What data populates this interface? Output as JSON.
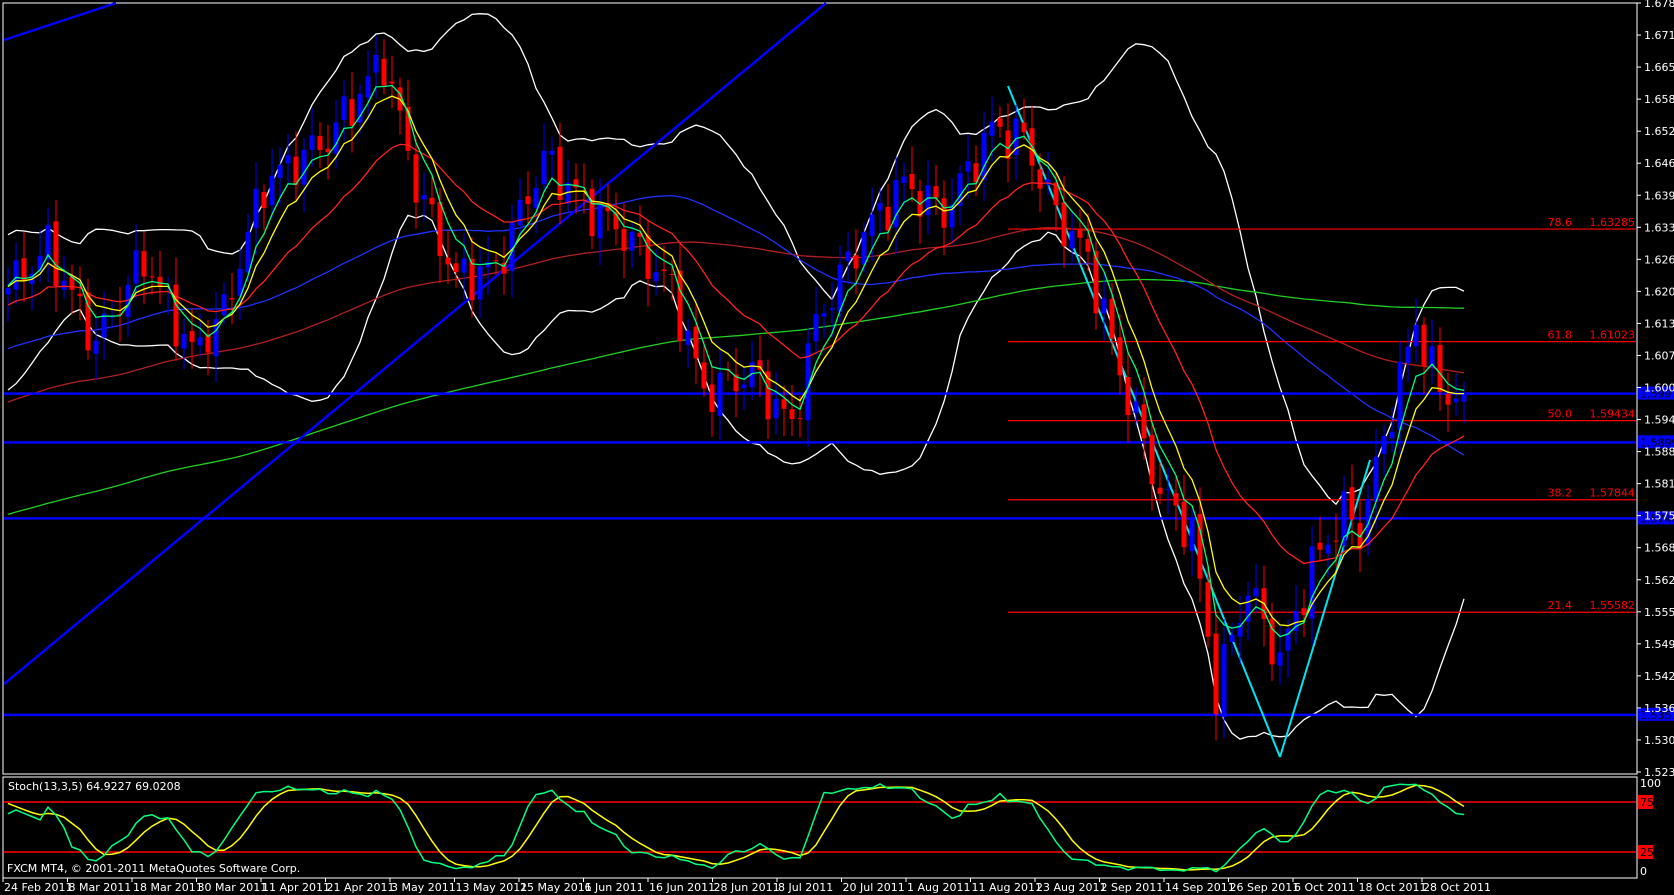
{
  "chart_data": {
    "type": "candlestick",
    "symbol_info": "FXCM MT4, © 2001-2011 MetaQuotes Software Corp.",
    "indicator_label": "Stoch(13,3,5) 64.9227 69.0208",
    "price_ticks": [
      "1.67830",
      "1.67190",
      "1.66550",
      "1.65890",
      "1.65250",
      "1.64610",
      "1.63970",
      "1.63310",
      "1.62670",
      "1.62030",
      "1.61390",
      "1.60730",
      "1.60090",
      "1.59450",
      "1.58810",
      "1.58170",
      "1.57530",
      "1.56870",
      "1.56230",
      "1.55590",
      "1.54930",
      "1.54290",
      "1.53650",
      "1.53010",
      "1.52370"
    ],
    "ylim": [
      1.5237,
      1.6783
    ],
    "stoch_ticks": [
      "100",
      "75",
      "25",
      "0"
    ],
    "stoch_levels": [
      75,
      25
    ],
    "date_labels": [
      "24 Feb 2011",
      "8 Mar 2011",
      "18 Mar 2011",
      "30 Mar 2011",
      "11 Apr 2011",
      "21 Apr 2011",
      "3 May 2011",
      "13 May 2011",
      "25 May 2011",
      "6 Jun 2011",
      "16 Jun 2011",
      "28 Jun 2011",
      "8 Jul 2011",
      "20 Jul 2011",
      "1 Aug 2011",
      "11 Aug 2011",
      "23 Aug 2011",
      "2 Sep 2011",
      "14 Sep 2011",
      "26 Sep 2011",
      "6 Oct 2011",
      "18 Oct 2011",
      "28 Oct 2011"
    ],
    "close_anchors": [
      [
        0,
        1.621
      ],
      [
        5,
        1.629
      ],
      [
        11,
        1.61
      ],
      [
        17,
        1.627
      ],
      [
        23,
        1.608
      ],
      [
        27,
        1.616
      ],
      [
        32,
        1.642
      ],
      [
        40,
        1.651
      ],
      [
        47,
        1.667
      ],
      [
        51,
        1.642
      ],
      [
        56,
        1.623
      ],
      [
        61,
        1.625
      ],
      [
        67,
        1.647
      ],
      [
        72,
        1.638
      ],
      [
        77,
        1.632
      ],
      [
        83,
        1.621
      ],
      [
        87,
        1.6
      ],
      [
        93,
        1.604
      ],
      [
        98,
        1.593
      ],
      [
        101,
        1.614
      ],
      [
        107,
        1.632
      ],
      [
        112,
        1.642
      ],
      [
        117,
        1.636
      ],
      [
        123,
        1.653
      ],
      [
        127,
        1.651
      ],
      [
        131,
        1.636
      ],
      [
        135,
        1.627
      ],
      [
        139,
        1.604
      ],
      [
        144,
        1.58
      ],
      [
        148,
        1.572
      ],
      [
        151,
        1.54
      ],
      [
        155,
        1.561
      ],
      [
        159,
        1.546
      ],
      [
        163,
        1.565
      ],
      [
        167,
        1.576
      ],
      [
        169,
        1.572
      ],
      [
        173,
        1.597
      ],
      [
        176,
        1.614
      ],
      [
        179,
        1.6
      ],
      [
        182,
        1.5998
      ]
    ],
    "horizontal_lines": [
      {
        "price": 1.59978,
        "label": "1.59978"
      },
      {
        "price": 1.58998,
        "label": "1.58998"
      },
      {
        "price": 1.57469,
        "label": "1.57469"
      },
      {
        "price": 1.53519,
        "label": "1.53519"
      }
    ],
    "fibonacci": [
      {
        "level": "78.6",
        "price": 1.63285,
        "label": "1.63285"
      },
      {
        "level": "61.8",
        "price": 1.61023,
        "label": "1.61023"
      },
      {
        "level": "50.0",
        "price": 1.59434,
        "label": "1.59434"
      },
      {
        "level": "38.2",
        "price": 1.57844,
        "label": "1.57844"
      },
      {
        "level": "21.4",
        "price": 1.55582,
        "label": "1.55582"
      }
    ],
    "colors": {
      "bull": "#0000ff",
      "bear": "#ff0000",
      "ema_fast": "#00ff7f",
      "ema_mid": "#ffff00",
      "ema_slow": "#ff2020",
      "sma55": "#2030ff",
      "sma100": "#b02020",
      "sma200": "#20d020",
      "bands": "#ffffff",
      "trend": "#0000ff",
      "trend2": "#00e5ee",
      "fib": "#ff0000"
    }
  }
}
